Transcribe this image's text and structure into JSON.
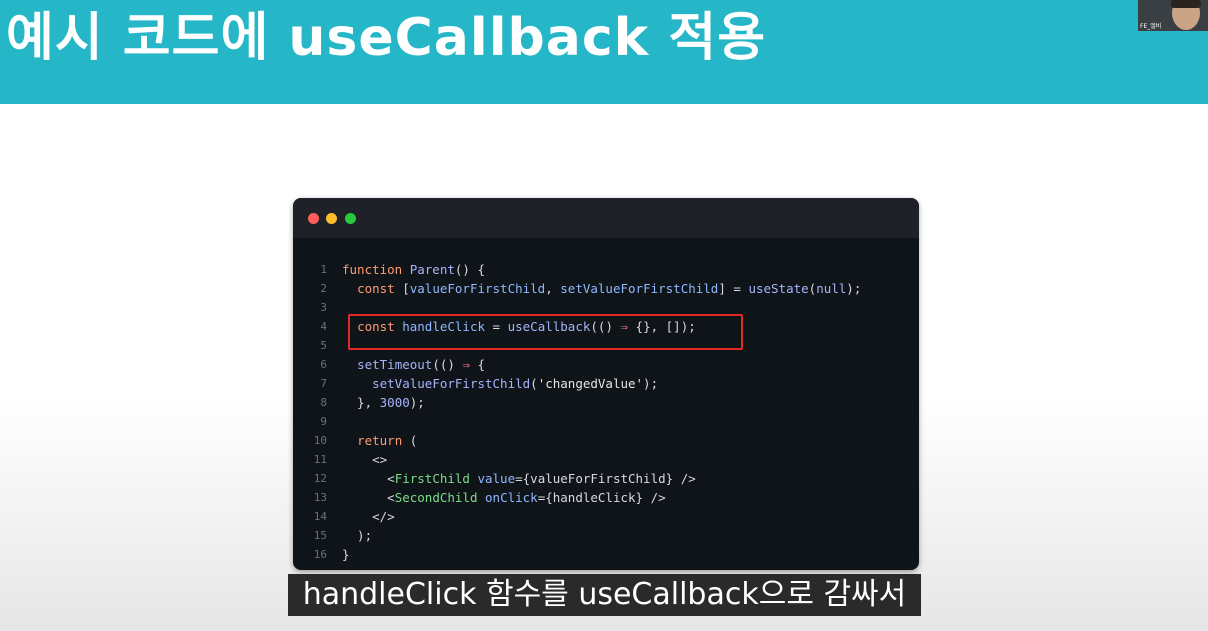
{
  "slide": {
    "title": "예시 코드에 useCallback 적용"
  },
  "webcam": {
    "label": "FE_엘비"
  },
  "code_window": {
    "lines": [
      {
        "num": "1",
        "tokens": [
          [
            "kw",
            "function "
          ],
          [
            "fn",
            "Parent"
          ],
          [
            "pn",
            "() {"
          ]
        ]
      },
      {
        "num": "2",
        "tokens": [
          [
            "pn",
            "  "
          ],
          [
            "kw",
            "const "
          ],
          [
            "pn",
            "["
          ],
          [
            "vr",
            "valueForFirstChild"
          ],
          [
            "pn",
            ", "
          ],
          [
            "vr",
            "setValueForFirstChild"
          ],
          [
            "pn",
            "] = "
          ],
          [
            "fn",
            "useState"
          ],
          [
            "pn",
            "("
          ],
          [
            "nm",
            "null"
          ],
          [
            "pn",
            ");"
          ]
        ]
      },
      {
        "num": "3",
        "tokens": []
      },
      {
        "num": "4",
        "tokens": [
          [
            "pn",
            "  "
          ],
          [
            "kw",
            "const "
          ],
          [
            "vr",
            "handleClick"
          ],
          [
            "pn",
            " = "
          ],
          [
            "fn",
            "useCallback"
          ],
          [
            "pn",
            "(() "
          ],
          [
            "ar",
            "⇒"
          ],
          [
            "pn",
            " {}, []);"
          ]
        ]
      },
      {
        "num": "5",
        "tokens": []
      },
      {
        "num": "6",
        "tokens": [
          [
            "pn",
            "  "
          ],
          [
            "fn",
            "setTimeout"
          ],
          [
            "pn",
            "(() "
          ],
          [
            "ar",
            "⇒"
          ],
          [
            "pn",
            " {"
          ]
        ]
      },
      {
        "num": "7",
        "tokens": [
          [
            "pn",
            "    "
          ],
          [
            "fn",
            "setValueForFirstChild"
          ],
          [
            "pn",
            "("
          ],
          [
            "st",
            "'changedValue'"
          ],
          [
            "pn",
            ");"
          ]
        ]
      },
      {
        "num": "8",
        "tokens": [
          [
            "pn",
            "  }, "
          ],
          [
            "nm",
            "3000"
          ],
          [
            "pn",
            ");"
          ]
        ]
      },
      {
        "num": "9",
        "tokens": []
      },
      {
        "num": "10",
        "tokens": [
          [
            "pn",
            "  "
          ],
          [
            "kw",
            "return "
          ],
          [
            "pn",
            "("
          ]
        ]
      },
      {
        "num": "11",
        "tokens": [
          [
            "pn",
            "    "
          ],
          [
            "pn",
            "<>"
          ]
        ]
      },
      {
        "num": "12",
        "tokens": [
          [
            "pn",
            "      <"
          ],
          [
            "tg",
            "FirstChild"
          ],
          [
            "pn",
            " "
          ],
          [
            "at",
            "value"
          ],
          [
            "pn",
            "={valueForFirstChild} />"
          ]
        ]
      },
      {
        "num": "13",
        "tokens": [
          [
            "pn",
            "      <"
          ],
          [
            "tg",
            "SecondChild"
          ],
          [
            "pn",
            " "
          ],
          [
            "at",
            "onClick"
          ],
          [
            "pn",
            "={handleClick} />"
          ]
        ]
      },
      {
        "num": "14",
        "tokens": [
          [
            "pn",
            "    </>"
          ]
        ]
      },
      {
        "num": "15",
        "tokens": [
          [
            "pn",
            "  );"
          ]
        ]
      },
      {
        "num": "16",
        "tokens": [
          [
            "pn",
            "}"
          ]
        ]
      }
    ]
  },
  "subtitle": {
    "text": "handleClick 함수를 useCallback으로 감싸서"
  }
}
